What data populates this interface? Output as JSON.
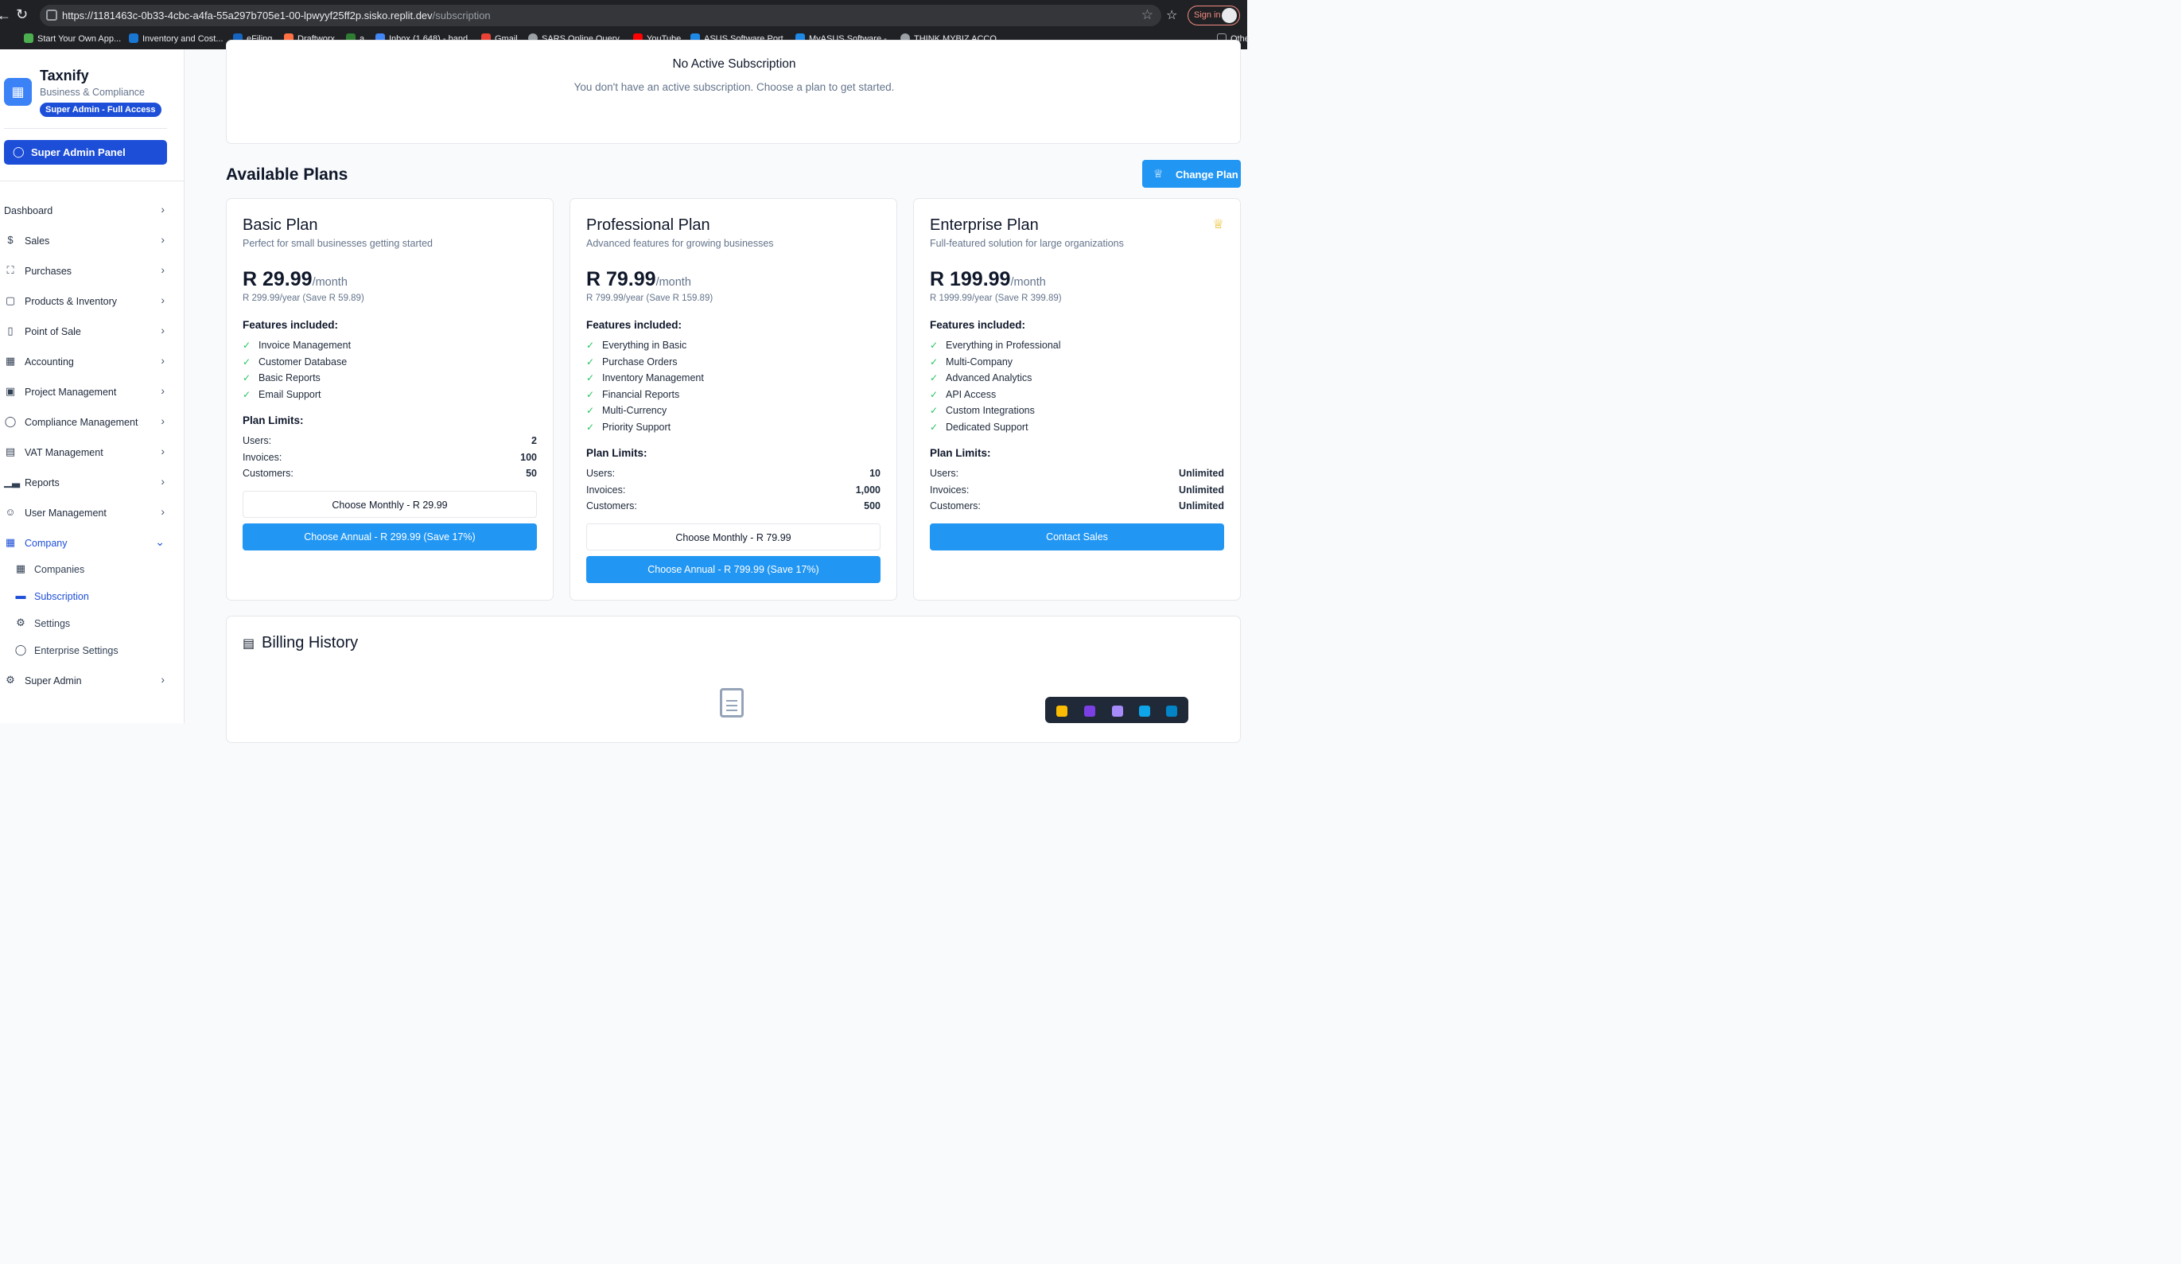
{
  "browser": {
    "url_main": "https://1181463c-0b33-4cbc-a4fa-55a297b705e1-00-lpwyyf25ff2p.sisko.replit.dev",
    "url_path": "/subscription",
    "signin_label": "Sign in",
    "bookmarks": [
      {
        "label": "Start Your Own App...",
        "color": "#4caf50"
      },
      {
        "label": "Inventory and Cost...",
        "color": "#1976d2"
      },
      {
        "label": "eFiling",
        "color": "#1565c0"
      },
      {
        "label": "Draftworx",
        "color": "#ff7043"
      },
      {
        "label": "a",
        "color": "#2e7d32"
      },
      {
        "label": "Inbox (1,648) - band...",
        "color": "#4285f4"
      },
      {
        "label": "Gmail",
        "color": "#ea4335"
      },
      {
        "label": "SARS Online Query...",
        "color": "#9aa0a6"
      },
      {
        "label": "YouTube",
        "color": "#ff0000"
      },
      {
        "label": "ASUS Software Port...",
        "color": "#1e88e5"
      },
      {
        "label": "MyASUS Software -...",
        "color": "#1e88e5"
      },
      {
        "label": "THINK MYBIZ ACCO...",
        "color": "#9aa0a6"
      },
      {
        "label": "Othe",
        "color": "#9aa0a6"
      }
    ]
  },
  "sidebar": {
    "brand": "Taxnify",
    "brand_sub": "Business & Compliance",
    "role_badge": "Super Admin - Full Access",
    "admin_panel_label": "Super Admin Panel",
    "nav": [
      {
        "label": "Dashboard",
        "icon": "none"
      },
      {
        "label": "Sales",
        "icon": "dollar-icon"
      },
      {
        "label": "Purchases",
        "icon": "truck-icon"
      },
      {
        "label": "Products & Inventory",
        "icon": "box-icon"
      },
      {
        "label": "Point of Sale",
        "icon": "tablet-icon"
      },
      {
        "label": "Accounting",
        "icon": "calculator-icon"
      },
      {
        "label": "Project Management",
        "icon": "briefcase-icon"
      },
      {
        "label": "Compliance Management",
        "icon": "shield-icon"
      },
      {
        "label": "VAT Management",
        "icon": "receipt-icon"
      },
      {
        "label": "Reports",
        "icon": "bar-chart-icon"
      },
      {
        "label": "User Management",
        "icon": "users-icon"
      },
      {
        "label": "Company",
        "icon": "building-icon"
      }
    ],
    "company_sub": [
      {
        "label": "Companies",
        "icon": "building-icon"
      },
      {
        "label": "Subscription",
        "icon": "credit-card-icon"
      },
      {
        "label": "Settings",
        "icon": "gear-icon"
      },
      {
        "label": "Enterprise Settings",
        "icon": "shield-icon"
      }
    ],
    "super_admin_label": "Super Admin"
  },
  "main": {
    "no_sub_title": "No Active Subscription",
    "no_sub_desc": "You don't have an active subscription. Choose a plan to get started.",
    "plans_title": "Available Plans",
    "change_plan_label": "Change Plan",
    "features_heading": "Features included:",
    "limits_heading": "Plan Limits:",
    "limit_labels": {
      "users": "Users:",
      "invoices": "Invoices:",
      "customers": "Customers:"
    },
    "plans": [
      {
        "name": "Basic Plan",
        "desc": "Perfect for small businesses getting started",
        "price": "R 29.99",
        "per": "/month",
        "yearly": "R 299.99/year (Save R 59.89)",
        "features": [
          "Invoice Management",
          "Customer Database",
          "Basic Reports",
          "Email Support"
        ],
        "limits": {
          "users": "2",
          "invoices": "100",
          "customers": "50"
        },
        "monthly_btn": "Choose Monthly - R 29.99",
        "annual_btn": "Choose Annual - R 299.99 (Save 17%)"
      },
      {
        "name": "Professional Plan",
        "desc": "Advanced features for growing businesses",
        "price": "R 79.99",
        "per": "/month",
        "yearly": "R 799.99/year (Save R 159.89)",
        "features": [
          "Everything in Basic",
          "Purchase Orders",
          "Inventory Management",
          "Financial Reports",
          "Multi-Currency",
          "Priority Support"
        ],
        "limits": {
          "users": "10",
          "invoices": "1,000",
          "customers": "500"
        },
        "monthly_btn": "Choose Monthly - R 79.99",
        "annual_btn": "Choose Annual - R 799.99 (Save 17%)"
      },
      {
        "name": "Enterprise Plan",
        "desc": "Full-featured solution for large organizations",
        "price": "R 199.99",
        "per": "/month",
        "yearly": "R 1999.99/year (Save R 399.89)",
        "features": [
          "Everything in Professional",
          "Multi-Company",
          "Advanced Analytics",
          "API Access",
          "Custom Integrations",
          "Dedicated Support"
        ],
        "limits": {
          "users": "Unlimited",
          "invoices": "Unlimited",
          "customers": "Unlimited"
        },
        "contact_btn": "Contact Sales"
      }
    ],
    "billing_title": "Billing History"
  },
  "colors": {
    "accent": "#2196f3",
    "brand_blue": "#1d4ed8",
    "check": "#22c55e",
    "crown": "#eab308"
  }
}
